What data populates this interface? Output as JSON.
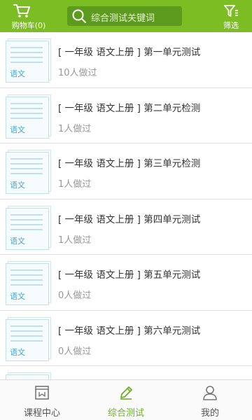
{
  "header": {
    "cart_label": "购物车(0)",
    "search_placeholder": "综合测试关键词",
    "filter_label": "筛选"
  },
  "list": {
    "items": [
      {
        "title": "[ 一年级 语文上册 ] 第一单元测试",
        "count": "10人做过",
        "subject": "语文"
      },
      {
        "title": "[ 一年级 语文上册 ] 第二单元检测",
        "count": "1人做过",
        "subject": "语文"
      },
      {
        "title": "[ 一年级 语文上册 ] 第三单元检测",
        "count": "1人做过",
        "subject": "语文"
      },
      {
        "title": "[ 一年级 语文上册 ] 第四单元测试",
        "count": "1人做过",
        "subject": "语文"
      },
      {
        "title": "[ 一年级 语文上册 ] 第五单元测试",
        "count": "0人做过",
        "subject": "语文"
      },
      {
        "title": "[ 一年级 语文上册 ] 第六单元测试",
        "count": "0人做过",
        "subject": "语文"
      }
    ]
  },
  "tabbar": {
    "tabs": [
      {
        "label": "课程中心",
        "icon": "course-icon"
      },
      {
        "label": "综合测试",
        "icon": "pencil-icon"
      },
      {
        "label": "我的",
        "icon": "user-icon"
      }
    ],
    "active_index": 1
  },
  "colors": {
    "header_bg": "#7dbd24",
    "search_bg": "#5d9b1e",
    "active_tab": "#6db120",
    "thumb_accent": "#4aa6cc"
  }
}
